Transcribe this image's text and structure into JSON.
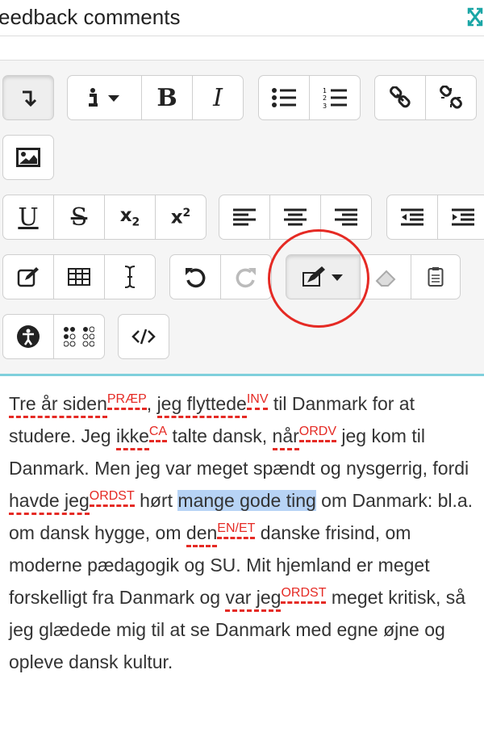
{
  "header": {
    "title": "eedback comments",
    "expand_icon": "expand-icon"
  },
  "toolbar": {
    "buttons": [
      {
        "name": "show-more-button",
        "icon": "arrow-down-icon"
      },
      {
        "name": "paragraph-style-button",
        "icon": "info-icon"
      },
      {
        "name": "bold-button",
        "label": "B"
      },
      {
        "name": "italic-button",
        "label": "I"
      },
      {
        "name": "unordered-list-button",
        "icon": "bullet-list-icon"
      },
      {
        "name": "ordered-list-button",
        "icon": "numbered-list-icon"
      },
      {
        "name": "link-button",
        "icon": "link-icon"
      },
      {
        "name": "unlink-button",
        "icon": "unlink-icon"
      },
      {
        "name": "image-button",
        "icon": "image-icon"
      },
      {
        "name": "underline-button",
        "label": "U"
      },
      {
        "name": "strikethrough-button",
        "label": "S"
      },
      {
        "name": "subscript-button",
        "label": "x",
        "sub": "2"
      },
      {
        "name": "superscript-button",
        "label": "x",
        "sup": "2"
      },
      {
        "name": "align-left-button",
        "icon": "align-left-icon"
      },
      {
        "name": "align-center-button",
        "icon": "align-center-icon"
      },
      {
        "name": "align-right-button",
        "icon": "align-right-icon"
      },
      {
        "name": "outdent-button",
        "icon": "outdent-icon"
      },
      {
        "name": "indent-button",
        "icon": "indent-icon"
      },
      {
        "name": "equation-button",
        "icon": "edit-icon"
      },
      {
        "name": "table-button",
        "icon": "table-icon"
      },
      {
        "name": "special-char-button",
        "icon": "text-cursor-icon"
      },
      {
        "name": "undo-button",
        "icon": "undo-icon"
      },
      {
        "name": "redo-button",
        "icon": "redo-icon"
      },
      {
        "name": "annotate-button",
        "icon": "marker-icon"
      },
      {
        "name": "clear-format-button",
        "icon": "eraser-icon"
      },
      {
        "name": "paste-button",
        "icon": "clipboard-icon"
      },
      {
        "name": "accessibility-checker-button",
        "icon": "accessibility-icon"
      },
      {
        "name": "screenreader-helper-button",
        "icon": "braille-icon"
      },
      {
        "name": "html-button",
        "icon": "code-icon"
      }
    ],
    "highlight_color": "#e52a24"
  },
  "editor": {
    "segments": [
      {
        "text": "Tre år siden",
        "err": true,
        "tag": "PRÆP"
      },
      {
        "text": ", "
      },
      {
        "text": "jeg flyttede",
        "err": true,
        "tag": "INV"
      },
      {
        "text": " til Danmark for at studere. Jeg "
      },
      {
        "text": "ikke",
        "err": true,
        "tag": "CA"
      },
      {
        "text": " talte dansk, "
      },
      {
        "text": "når",
        "err": true,
        "tag": "ORDV"
      },
      {
        "text": " jeg kom til Danmark. Men jeg var meget spændt og nysgerrig, fordi "
      },
      {
        "text": "havde jeg",
        "err": true,
        "tag": "ORDST"
      },
      {
        "text": " hørt "
      },
      {
        "text": "mange gode ting",
        "hl": true
      },
      {
        "text": " om Danmark: bl.a. om dansk hygge, om "
      },
      {
        "text": "den",
        "err": true,
        "tag": "EN/ET"
      },
      {
        "text": " danske frisind, om moderne pædagogik og SU. Mit hjemland er meget forskelligt fra Danmark og "
      },
      {
        "text": "var jeg",
        "err": true,
        "tag": "ORDST"
      },
      {
        "text": " meget kritisk, så jeg glædede mig til at se Danmark med egne øjne og opleve dansk kultur."
      }
    ]
  }
}
